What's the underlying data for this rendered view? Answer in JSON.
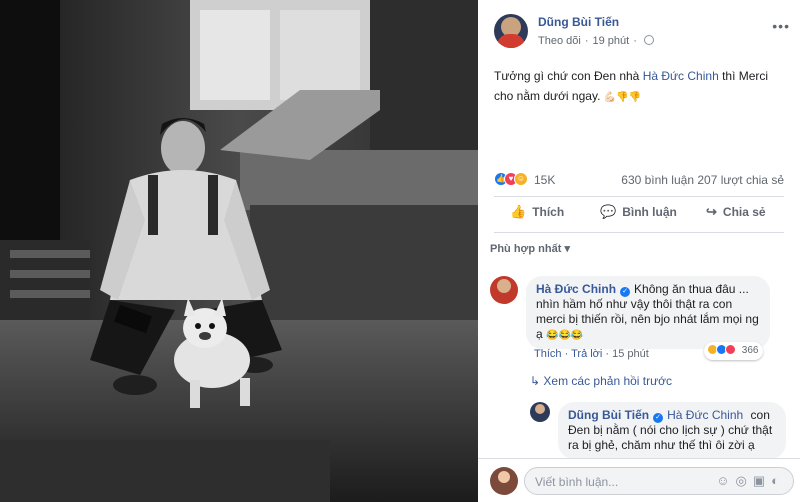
{
  "post": {
    "author": "Dũng Bùi Tiến",
    "follow": "Theo dõi",
    "time": "19 phút",
    "text_before": "Tưởng gì chứ con Đen nhà ",
    "mention": "Hà Đức Chinh",
    "text_after": " thì Merci cho nằm dưới ngay.",
    "more_icon": "more-icon",
    "close_icon": "close-icon"
  },
  "stats": {
    "reactions": "15K",
    "comments": "630 bình luận",
    "shares": "207 lượt chia sẻ"
  },
  "actions": {
    "like": "Thích",
    "comment": "Bình luận",
    "share": "Chia sẻ"
  },
  "sort_label": "Phù hợp nhất",
  "comment1": {
    "author": "Hà Đức Chinh",
    "text": "Không ăn thua đâu ... nhìn hầm hố như vậy thôi thật ra con merci bị thiến rồi, nên bjo nhát lắm mọi ng ạ",
    "like": "Thích",
    "reply": "Trả lời",
    "time": "15 phút",
    "reaction_count": "366"
  },
  "view_previous": "Xem các phản hồi trước",
  "reply1": {
    "author": "Dũng Bùi Tiến",
    "mention": "Hà Đức Chinh",
    "text": "con Đen bị nằm ( nói cho lịch sự ) chứ thật ra bị ghẻ, chăm như thế thì ôi zời ạ"
  },
  "composer": {
    "placeholder": "Viết bình luận..."
  },
  "colors": {
    "link": "#385898",
    "like_blue": "#1877f2",
    "panel_bg": "#ffffff"
  }
}
